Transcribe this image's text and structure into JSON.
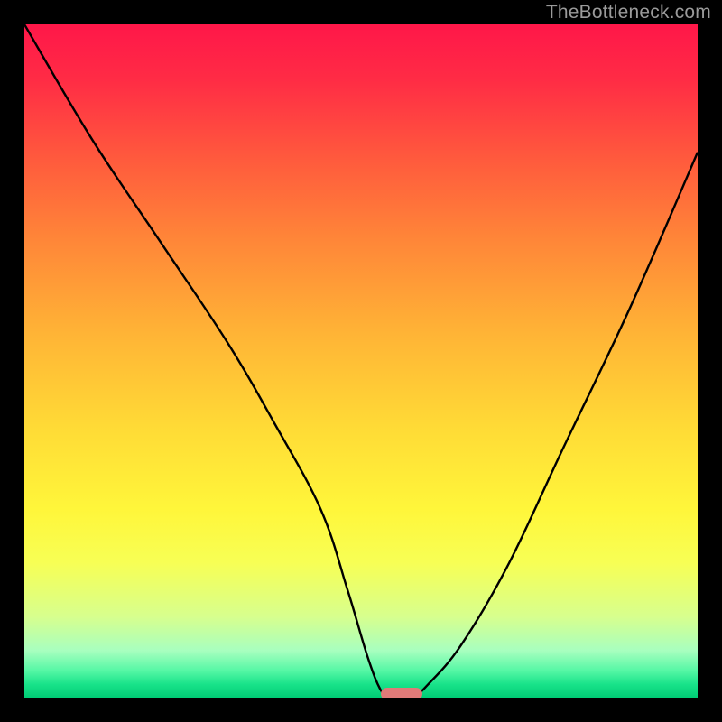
{
  "watermark": "TheBottleneck.com",
  "chart_data": {
    "type": "line",
    "title": "",
    "xlabel": "",
    "ylabel": "",
    "xlim": [
      0,
      100
    ],
    "ylim": [
      0,
      100
    ],
    "grid": false,
    "background_gradient_colors": [
      "#ff1749",
      "#ffdb36",
      "#00cc75"
    ],
    "series": [
      {
        "name": "bottleneck-curve",
        "x": [
          0,
          10,
          20,
          30,
          37,
          44,
          48,
          51,
          53,
          54.5,
          57.5,
          60,
          65,
          72,
          80,
          90,
          100
        ],
        "values": [
          100,
          83,
          68,
          53,
          41,
          28,
          16,
          6,
          1,
          0,
          0,
          2,
          8,
          20,
          37,
          58,
          81
        ]
      }
    ],
    "marker": {
      "x": 56,
      "y": 0,
      "color": "#e07a78"
    },
    "minimum_at_x": 56
  }
}
